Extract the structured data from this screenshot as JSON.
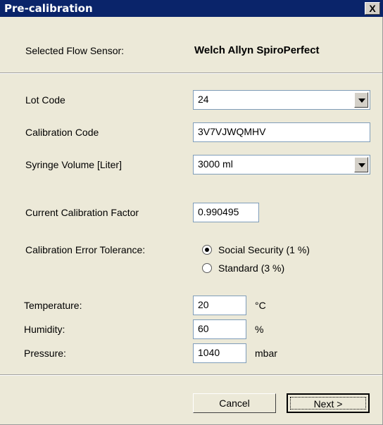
{
  "window": {
    "title": "Pre-calibration",
    "close_label": "X"
  },
  "sensor": {
    "label": "Selected Flow Sensor:",
    "value": "Welch Allyn SpiroPerfect"
  },
  "lot_code": {
    "label": "Lot Code",
    "value": "24"
  },
  "calibration_code": {
    "label": "Calibration Code",
    "value": "3V7VJWQMHV"
  },
  "syringe_volume": {
    "label": "Syringe Volume [Liter]",
    "value": "3000 ml"
  },
  "current_factor": {
    "label": "Current Calibration Factor",
    "value": "0.990495"
  },
  "tolerance": {
    "label": "Calibration Error Tolerance:",
    "options": [
      {
        "label": "Social Security (1 %)",
        "checked": true
      },
      {
        "label": "Standard (3 %)",
        "checked": false
      }
    ]
  },
  "temperature": {
    "label": "Temperature:",
    "value": "20",
    "unit": "°C"
  },
  "humidity": {
    "label": "Humidity:",
    "value": "60",
    "unit": "%"
  },
  "pressure": {
    "label": "Pressure:",
    "value": "1040",
    "unit": "mbar"
  },
  "buttons": {
    "cancel": "Cancel",
    "next": "Next >"
  }
}
